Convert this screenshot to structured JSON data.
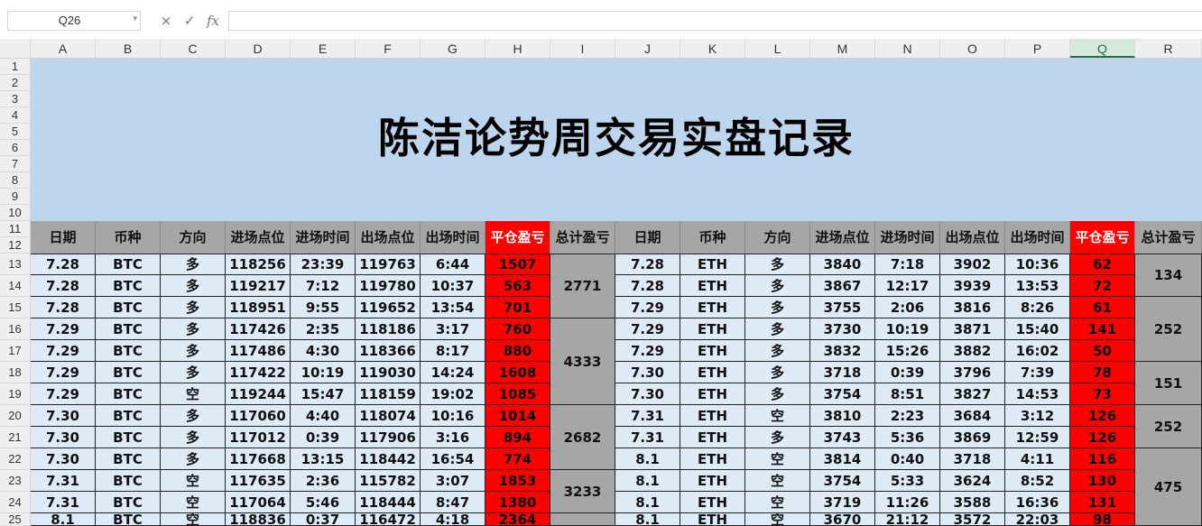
{
  "formula_bar": {
    "name_box": "Q26",
    "cancel_icon": "×",
    "enter_icon": "✓",
    "fx_label": "fx",
    "formula": ""
  },
  "columns": [
    "A",
    "B",
    "C",
    "D",
    "E",
    "F",
    "G",
    "H",
    "I",
    "J",
    "K",
    "L",
    "M",
    "N",
    "O",
    "P",
    "Q",
    "R"
  ],
  "selected_column": "Q",
  "rows": [
    "1",
    "2",
    "3",
    "4",
    "5",
    "6",
    "7",
    "8",
    "9",
    "10",
    "11",
    "12",
    "13",
    "14",
    "15",
    "16",
    "17",
    "18",
    "19",
    "20",
    "21",
    "22",
    "23",
    "24",
    "25"
  ],
  "title": "陈洁论势周交易实盘记录",
  "headers": [
    "日期",
    "币种",
    "方向",
    "进场点位",
    "进场时间",
    "出场点位",
    "出场时间",
    "平仓盈亏",
    "总计盈亏",
    "日期",
    "币种",
    "方向",
    "进场点位",
    "进场时间",
    "出场点位",
    "出场时间",
    "平仓盈亏",
    "总计盈亏"
  ],
  "colors": {
    "header_gray": "#a6a6a6",
    "title_blue": "#bdd6ee",
    "data_blue": "#deebf7",
    "pnl_red": "#ff0000",
    "select_green": "#1f7145"
  },
  "btc": [
    [
      "7.28",
      "BTC",
      "多",
      "118256",
      "23:39",
      "119763",
      "6:44",
      "1507"
    ],
    [
      "7.28",
      "BTC",
      "多",
      "119217",
      "7:12",
      "119780",
      "10:37",
      "563"
    ],
    [
      "7.28",
      "BTC",
      "多",
      "118951",
      "9:55",
      "119652",
      "13:54",
      "701"
    ],
    [
      "7.29",
      "BTC",
      "多",
      "117426",
      "2:35",
      "118186",
      "3:17",
      "760"
    ],
    [
      "7.29",
      "BTC",
      "多",
      "117486",
      "4:30",
      "118366",
      "8:17",
      "880"
    ],
    [
      "7.29",
      "BTC",
      "多",
      "117422",
      "10:19",
      "119030",
      "14:24",
      "1608"
    ],
    [
      "7.29",
      "BTC",
      "空",
      "119244",
      "15:47",
      "118159",
      "19:02",
      "1085"
    ],
    [
      "7.30",
      "BTC",
      "多",
      "117060",
      "4:40",
      "118074",
      "10:16",
      "1014"
    ],
    [
      "7.30",
      "BTC",
      "多",
      "117012",
      "0:39",
      "117906",
      "3:16",
      "894"
    ],
    [
      "7.30",
      "BTC",
      "多",
      "117668",
      "13:15",
      "118442",
      "16:54",
      "774"
    ],
    [
      "7.31",
      "BTC",
      "空",
      "117635",
      "2:36",
      "115782",
      "3:07",
      "1853"
    ],
    [
      "7.31",
      "BTC",
      "空",
      "117064",
      "5:46",
      "118444",
      "8:47",
      "1380"
    ],
    [
      "8.1",
      "BTC",
      "空",
      "118836",
      "0:37",
      "116472",
      "4:18",
      "2364"
    ]
  ],
  "btc_totals": [
    "2771",
    "4333",
    "2682",
    "3233"
  ],
  "eth": [
    [
      "7.28",
      "ETH",
      "多",
      "3840",
      "7:18",
      "3902",
      "10:36",
      "62"
    ],
    [
      "7.28",
      "ETH",
      "多",
      "3867",
      "12:17",
      "3939",
      "13:53",
      "72"
    ],
    [
      "7.29",
      "ETH",
      "多",
      "3755",
      "2:06",
      "3816",
      "8:26",
      "61"
    ],
    [
      "7.29",
      "ETH",
      "多",
      "3730",
      "10:19",
      "3871",
      "15:40",
      "141"
    ],
    [
      "7.29",
      "ETH",
      "多",
      "3832",
      "15:26",
      "3882",
      "16:02",
      "50"
    ],
    [
      "7.30",
      "ETH",
      "多",
      "3718",
      "0:39",
      "3796",
      "7:39",
      "78"
    ],
    [
      "7.30",
      "ETH",
      "多",
      "3754",
      "8:51",
      "3827",
      "14:53",
      "73"
    ],
    [
      "7.31",
      "ETH",
      "空",
      "3810",
      "2:23",
      "3684",
      "3:12",
      "126"
    ],
    [
      "7.31",
      "ETH",
      "多",
      "3743",
      "5:36",
      "3869",
      "12:59",
      "126"
    ],
    [
      "8.1",
      "ETH",
      "空",
      "3814",
      "0:40",
      "3718",
      "4:11",
      "116"
    ],
    [
      "8.1",
      "ETH",
      "空",
      "3754",
      "5:33",
      "3624",
      "8:52",
      "130"
    ],
    [
      "8.1",
      "ETH",
      "空",
      "3719",
      "11:26",
      "3588",
      "16:36",
      "131"
    ],
    [
      "8.1",
      "ETH",
      "空",
      "3670",
      "21:12",
      "3572",
      "22:03",
      "98"
    ]
  ],
  "eth_totals": [
    "134",
    "252",
    "151",
    "252",
    "475"
  ]
}
